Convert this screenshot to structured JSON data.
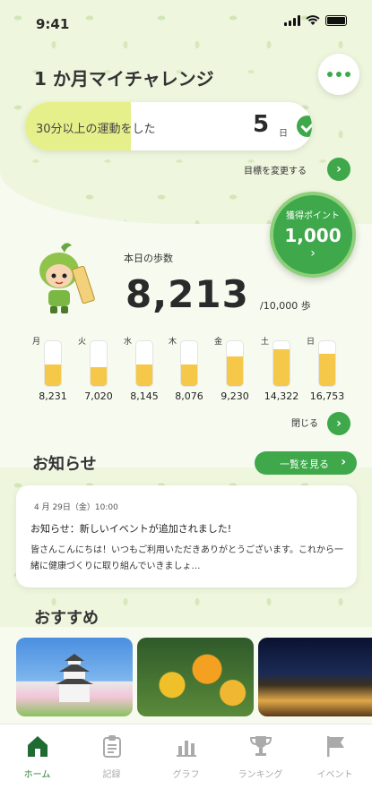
{
  "status_bar": {
    "time": "9:41"
  },
  "header": {
    "title": "1 か月マイチャレンジ"
  },
  "challenge": {
    "text": "30分以上の運動をした",
    "count": "5",
    "unit": "日",
    "progress": 0.37
  },
  "change_goal_label": "目標を変更する",
  "points": {
    "label": "獲得ポイント",
    "value": "1,000"
  },
  "steps": {
    "label": "本日の歩数",
    "value": "8,213",
    "goal": "/10,000 歩"
  },
  "week": [
    {
      "day": "月",
      "value": "8,231",
      "level": 0.49
    },
    {
      "day": "火",
      "value": "7,020",
      "level": 0.42
    },
    {
      "day": "水",
      "value": "8,145",
      "level": 0.49
    },
    {
      "day": "木",
      "value": "8,076",
      "level": 0.48
    },
    {
      "day": "金",
      "value": "9,230",
      "level": 0.67
    },
    {
      "day": "土",
      "value": "14,322",
      "level": 0.83
    },
    {
      "day": "日",
      "value": "16,753",
      "level": 0.72
    }
  ],
  "close_label": "閉じる",
  "news": {
    "title": "お知らせ",
    "list_button": "一覧を見る",
    "date": "4 月 29日（金）10:00",
    "headline": "お知らせ：新しいイベントが追加されました!",
    "body": "皆さんこんにちは！いつもご利用いただきありがとうございます。これから一緒に健康づくりに取り組んでいきましょ…"
  },
  "recommend": {
    "title": "おすすめ"
  },
  "tabs": [
    {
      "label": "ホーム",
      "icon": "home-icon"
    },
    {
      "label": "記録",
      "icon": "clipboard-icon"
    },
    {
      "label": "グラフ",
      "icon": "bar-chart-icon"
    },
    {
      "label": "ランキング",
      "icon": "trophy-icon"
    },
    {
      "label": "イベント",
      "icon": "flag-icon"
    }
  ],
  "colors": {
    "accent": "#3ea84a",
    "bar_fill": "#f5c84a",
    "challenge_fill": "#e6f08a"
  }
}
